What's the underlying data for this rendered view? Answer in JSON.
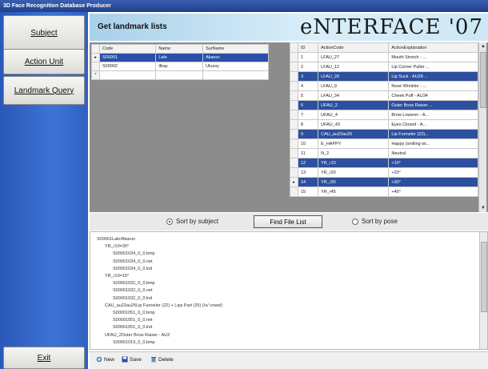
{
  "window": {
    "title": "3D Face Recognition Database Producer"
  },
  "sidebar": {
    "buttons": [
      {
        "label": "Subject"
      },
      {
        "label": "Action Unit"
      },
      {
        "label": "Landmark Query"
      }
    ],
    "exit_label": "Exit"
  },
  "header": {
    "title": "Get landmark lists",
    "logo": "eNTERFACE '07"
  },
  "subjects_table": {
    "columns": [
      "Code",
      "Name",
      "SurName"
    ],
    "rows": [
      {
        "code": "S00001",
        "name": "Lale",
        "surname": "Akarun",
        "selected": true
      },
      {
        "code": "S00002",
        "name": "Ilkay",
        "surname": "Ulusoy",
        "selected": false
      }
    ],
    "new_row_marker": "*"
  },
  "au_table": {
    "columns": [
      "ID",
      "ActionCode",
      "ActionExplanation"
    ],
    "rows": [
      {
        "id": "1",
        "code": "LFAU_27",
        "expl": "Mouth Stretch - ...",
        "hl": false
      },
      {
        "id": "2",
        "code": "LFAU_12",
        "expl": "Lip Corner Puller ...",
        "hl": false
      },
      {
        "id": "3",
        "code": "LFAU_28",
        "expl": "Lip Suck - AU28 ...",
        "hl": true
      },
      {
        "id": "4",
        "code": "LFAU_9",
        "expl": "Nose Wrinkler - ...",
        "hl": false
      },
      {
        "id": "5",
        "code": "LFAU_34",
        "expl": "Cheek Puff - AU34",
        "hl": false
      },
      {
        "id": "6",
        "code": "UFAU_2",
        "expl": "Outer Brow Raiser ...",
        "hl": true
      },
      {
        "id": "7",
        "code": "UFAU_4",
        "expl": "Brow Lowerer - A...",
        "hl": false
      },
      {
        "id": "8",
        "code": "UFAU_43",
        "expl": "Eyes Closed - A...",
        "hl": false
      },
      {
        "id": "9",
        "code": "CAU_au22au25",
        "expl": "Lip Funneler (22)...",
        "hl": true
      },
      {
        "id": "10",
        "code": "E_HAPPY",
        "expl": "Happy (smiling wi...",
        "hl": false
      },
      {
        "id": "11",
        "code": "N_2",
        "expl": "Neutral",
        "hl": false
      },
      {
        "id": "12",
        "code": "YR_r10",
        "expl": "+10°",
        "hl": true
      },
      {
        "id": "13",
        "code": "YR_r20",
        "expl": "+20°",
        "hl": false
      },
      {
        "id": "14",
        "code": "YR_r30",
        "expl": "+30°",
        "hl": true
      },
      {
        "id": "15",
        "code": "YR_r45",
        "expl": "+45°",
        "hl": false
      }
    ]
  },
  "sortbar": {
    "sort_subject": "Sort by subject",
    "sort_pose": "Sort by pose",
    "find_button": "Find File List"
  },
  "tree": {
    "lines": [
      {
        "indent": 0,
        "text": "S00001Lale/Akarun"
      },
      {
        "indent": 1,
        "text": "YR_r10=30°"
      },
      {
        "indent": 2,
        "text": "S00001034_0_0.bmp"
      },
      {
        "indent": 2,
        "text": "S00001034_0_0.net"
      },
      {
        "indent": 2,
        "text": "S00001034_0_0.lnd"
      },
      {
        "indent": 1,
        "text": "YR_r10=10°"
      },
      {
        "indent": 2,
        "text": "S00001032_0_0.bmp"
      },
      {
        "indent": 2,
        "text": "S00001032_0_0.net"
      },
      {
        "indent": 2,
        "text": "S00001032_0_0.lnd"
      },
      {
        "indent": 1,
        "text": "CAU_au22au25Lip Funneler (22) + Lips Part (25) (/o/ vowel)"
      },
      {
        "indent": 2,
        "text": "S00001051_0_0.bmp"
      },
      {
        "indent": 2,
        "text": "S00001051_0_0.net"
      },
      {
        "indent": 2,
        "text": "S00001051_0_0.lnd"
      },
      {
        "indent": 1,
        "text": "UFAU_2Outer Brow Raiser - AU2"
      },
      {
        "indent": 2,
        "text": "S00001019_0_0.bmp"
      }
    ]
  },
  "toolbar": {
    "new_label": "New",
    "save_label": "Save",
    "delete_label": "Delete"
  }
}
